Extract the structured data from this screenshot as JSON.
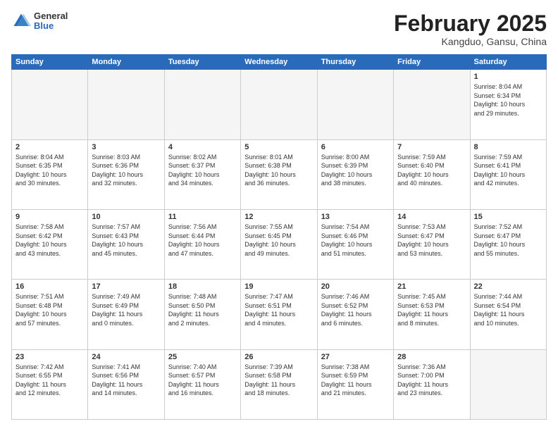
{
  "header": {
    "logo": {
      "general": "General",
      "blue": "Blue"
    },
    "month": "February 2025",
    "location": "Kangduo, Gansu, China"
  },
  "weekdays": [
    "Sunday",
    "Monday",
    "Tuesday",
    "Wednesday",
    "Thursday",
    "Friday",
    "Saturday"
  ],
  "weeks": [
    [
      {
        "day": "",
        "info": ""
      },
      {
        "day": "",
        "info": ""
      },
      {
        "day": "",
        "info": ""
      },
      {
        "day": "",
        "info": ""
      },
      {
        "day": "",
        "info": ""
      },
      {
        "day": "",
        "info": ""
      },
      {
        "day": "1",
        "info": "Sunrise: 8:04 AM\nSunset: 6:34 PM\nDaylight: 10 hours\nand 29 minutes."
      }
    ],
    [
      {
        "day": "2",
        "info": "Sunrise: 8:04 AM\nSunset: 6:35 PM\nDaylight: 10 hours\nand 30 minutes."
      },
      {
        "day": "3",
        "info": "Sunrise: 8:03 AM\nSunset: 6:36 PM\nDaylight: 10 hours\nand 32 minutes."
      },
      {
        "day": "4",
        "info": "Sunrise: 8:02 AM\nSunset: 6:37 PM\nDaylight: 10 hours\nand 34 minutes."
      },
      {
        "day": "5",
        "info": "Sunrise: 8:01 AM\nSunset: 6:38 PM\nDaylight: 10 hours\nand 36 minutes."
      },
      {
        "day": "6",
        "info": "Sunrise: 8:00 AM\nSunset: 6:39 PM\nDaylight: 10 hours\nand 38 minutes."
      },
      {
        "day": "7",
        "info": "Sunrise: 7:59 AM\nSunset: 6:40 PM\nDaylight: 10 hours\nand 40 minutes."
      },
      {
        "day": "8",
        "info": "Sunrise: 7:59 AM\nSunset: 6:41 PM\nDaylight: 10 hours\nand 42 minutes."
      }
    ],
    [
      {
        "day": "9",
        "info": "Sunrise: 7:58 AM\nSunset: 6:42 PM\nDaylight: 10 hours\nand 43 minutes."
      },
      {
        "day": "10",
        "info": "Sunrise: 7:57 AM\nSunset: 6:43 PM\nDaylight: 10 hours\nand 45 minutes."
      },
      {
        "day": "11",
        "info": "Sunrise: 7:56 AM\nSunset: 6:44 PM\nDaylight: 10 hours\nand 47 minutes."
      },
      {
        "day": "12",
        "info": "Sunrise: 7:55 AM\nSunset: 6:45 PM\nDaylight: 10 hours\nand 49 minutes."
      },
      {
        "day": "13",
        "info": "Sunrise: 7:54 AM\nSunset: 6:46 PM\nDaylight: 10 hours\nand 51 minutes."
      },
      {
        "day": "14",
        "info": "Sunrise: 7:53 AM\nSunset: 6:47 PM\nDaylight: 10 hours\nand 53 minutes."
      },
      {
        "day": "15",
        "info": "Sunrise: 7:52 AM\nSunset: 6:47 PM\nDaylight: 10 hours\nand 55 minutes."
      }
    ],
    [
      {
        "day": "16",
        "info": "Sunrise: 7:51 AM\nSunset: 6:48 PM\nDaylight: 10 hours\nand 57 minutes."
      },
      {
        "day": "17",
        "info": "Sunrise: 7:49 AM\nSunset: 6:49 PM\nDaylight: 11 hours\nand 0 minutes."
      },
      {
        "day": "18",
        "info": "Sunrise: 7:48 AM\nSunset: 6:50 PM\nDaylight: 11 hours\nand 2 minutes."
      },
      {
        "day": "19",
        "info": "Sunrise: 7:47 AM\nSunset: 6:51 PM\nDaylight: 11 hours\nand 4 minutes."
      },
      {
        "day": "20",
        "info": "Sunrise: 7:46 AM\nSunset: 6:52 PM\nDaylight: 11 hours\nand 6 minutes."
      },
      {
        "day": "21",
        "info": "Sunrise: 7:45 AM\nSunset: 6:53 PM\nDaylight: 11 hours\nand 8 minutes."
      },
      {
        "day": "22",
        "info": "Sunrise: 7:44 AM\nSunset: 6:54 PM\nDaylight: 11 hours\nand 10 minutes."
      }
    ],
    [
      {
        "day": "23",
        "info": "Sunrise: 7:42 AM\nSunset: 6:55 PM\nDaylight: 11 hours\nand 12 minutes."
      },
      {
        "day": "24",
        "info": "Sunrise: 7:41 AM\nSunset: 6:56 PM\nDaylight: 11 hours\nand 14 minutes."
      },
      {
        "day": "25",
        "info": "Sunrise: 7:40 AM\nSunset: 6:57 PM\nDaylight: 11 hours\nand 16 minutes."
      },
      {
        "day": "26",
        "info": "Sunrise: 7:39 AM\nSunset: 6:58 PM\nDaylight: 11 hours\nand 18 minutes."
      },
      {
        "day": "27",
        "info": "Sunrise: 7:38 AM\nSunset: 6:59 PM\nDaylight: 11 hours\nand 21 minutes."
      },
      {
        "day": "28",
        "info": "Sunrise: 7:36 AM\nSunset: 7:00 PM\nDaylight: 11 hours\nand 23 minutes."
      },
      {
        "day": "",
        "info": ""
      }
    ]
  ]
}
